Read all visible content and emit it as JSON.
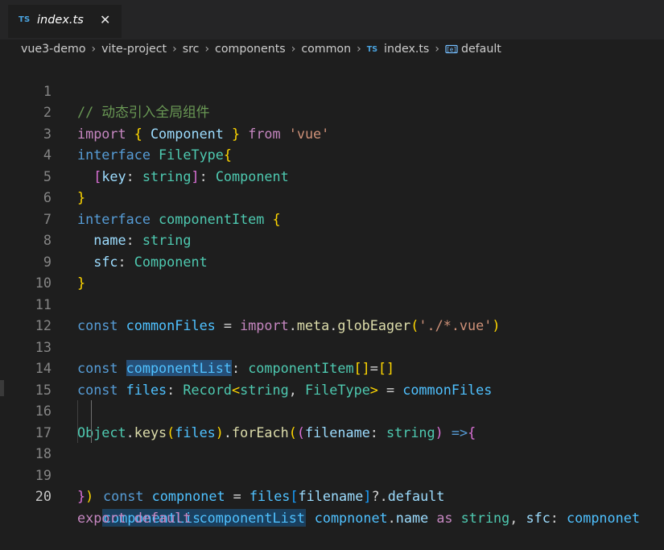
{
  "tab": {
    "badge": "TS",
    "title": "index.ts",
    "close": "✕"
  },
  "breadcrumb": {
    "items": [
      "vue3-demo",
      "vite-project",
      "src",
      "components",
      "common"
    ],
    "file_badge": "TS",
    "file": "index.ts",
    "symbol": "default"
  },
  "line_numbers": [
    "1",
    "2",
    "3",
    "4",
    "5",
    "6",
    "7",
    "8",
    "9",
    "10",
    "11",
    "12",
    "13",
    "14",
    "15",
    "16",
    "17",
    "18",
    "19",
    "20"
  ],
  "active_line": "20",
  "code": {
    "l1": [
      "// 动态引入全局组件"
    ],
    "l2": [
      "import",
      " ",
      "{",
      " ",
      "Component",
      " ",
      "}",
      " ",
      "from",
      " ",
      "'vue'"
    ],
    "l3": [
      "interface",
      " ",
      "FileType",
      "{"
    ],
    "l4": [
      "  ",
      "[",
      "key",
      ": ",
      "string",
      "]",
      ": ",
      "Component"
    ],
    "l5": [
      "}"
    ],
    "l6": [
      "interface",
      " ",
      "componentItem",
      " ",
      "{"
    ],
    "l7": [
      "  ",
      "name",
      ": ",
      "string"
    ],
    "l8": [
      "  ",
      "sfc",
      ": ",
      "Component"
    ],
    "l9": [
      "}"
    ],
    "l11": [
      "const",
      " ",
      "commonFiles",
      " = ",
      "import",
      ".",
      "meta",
      ".",
      "globEager",
      "(",
      "'./*.vue'",
      ")"
    ],
    "l13": [
      "const",
      " ",
      "componentList",
      ": ",
      "componentItem",
      "[]",
      "=",
      "[]"
    ],
    "l14": [
      "const",
      " ",
      "files",
      ": ",
      "Record",
      "<",
      "string",
      ", ",
      "FileType",
      ">",
      " = ",
      "commonFiles"
    ],
    "l16": [
      "Object",
      ".",
      "keys",
      "(",
      "files",
      ")",
      ".",
      "forEach",
      "(",
      "(",
      "filename",
      ": ",
      "string",
      ")",
      " ",
      "=>",
      "{"
    ],
    "l17": [
      "const",
      " ",
      "compnonet",
      " = ",
      "files",
      "[",
      "filename",
      "]",
      "?.",
      "default"
    ],
    "l18": [
      "componentList",
      ".",
      "push",
      "(",
      "{",
      "name",
      ": ",
      "compnonet",
      ".",
      "name",
      " ",
      "as",
      " ",
      "string",
      ", ",
      "sfc",
      ": ",
      "compnonet"
    ],
    "l19": [
      "}",
      ")"
    ],
    "l20": [
      "export",
      " ",
      "default",
      " ",
      "componentList"
    ]
  },
  "colors": {
    "background": "#1e1e1e",
    "tabbar": "#252526",
    "keyword": "#569cd6",
    "control": "#c586c0",
    "type": "#4ec9b0",
    "variable": "#9cdcfe",
    "function": "#dcdcaa",
    "string": "#ce9178",
    "comment": "#6a9955"
  }
}
